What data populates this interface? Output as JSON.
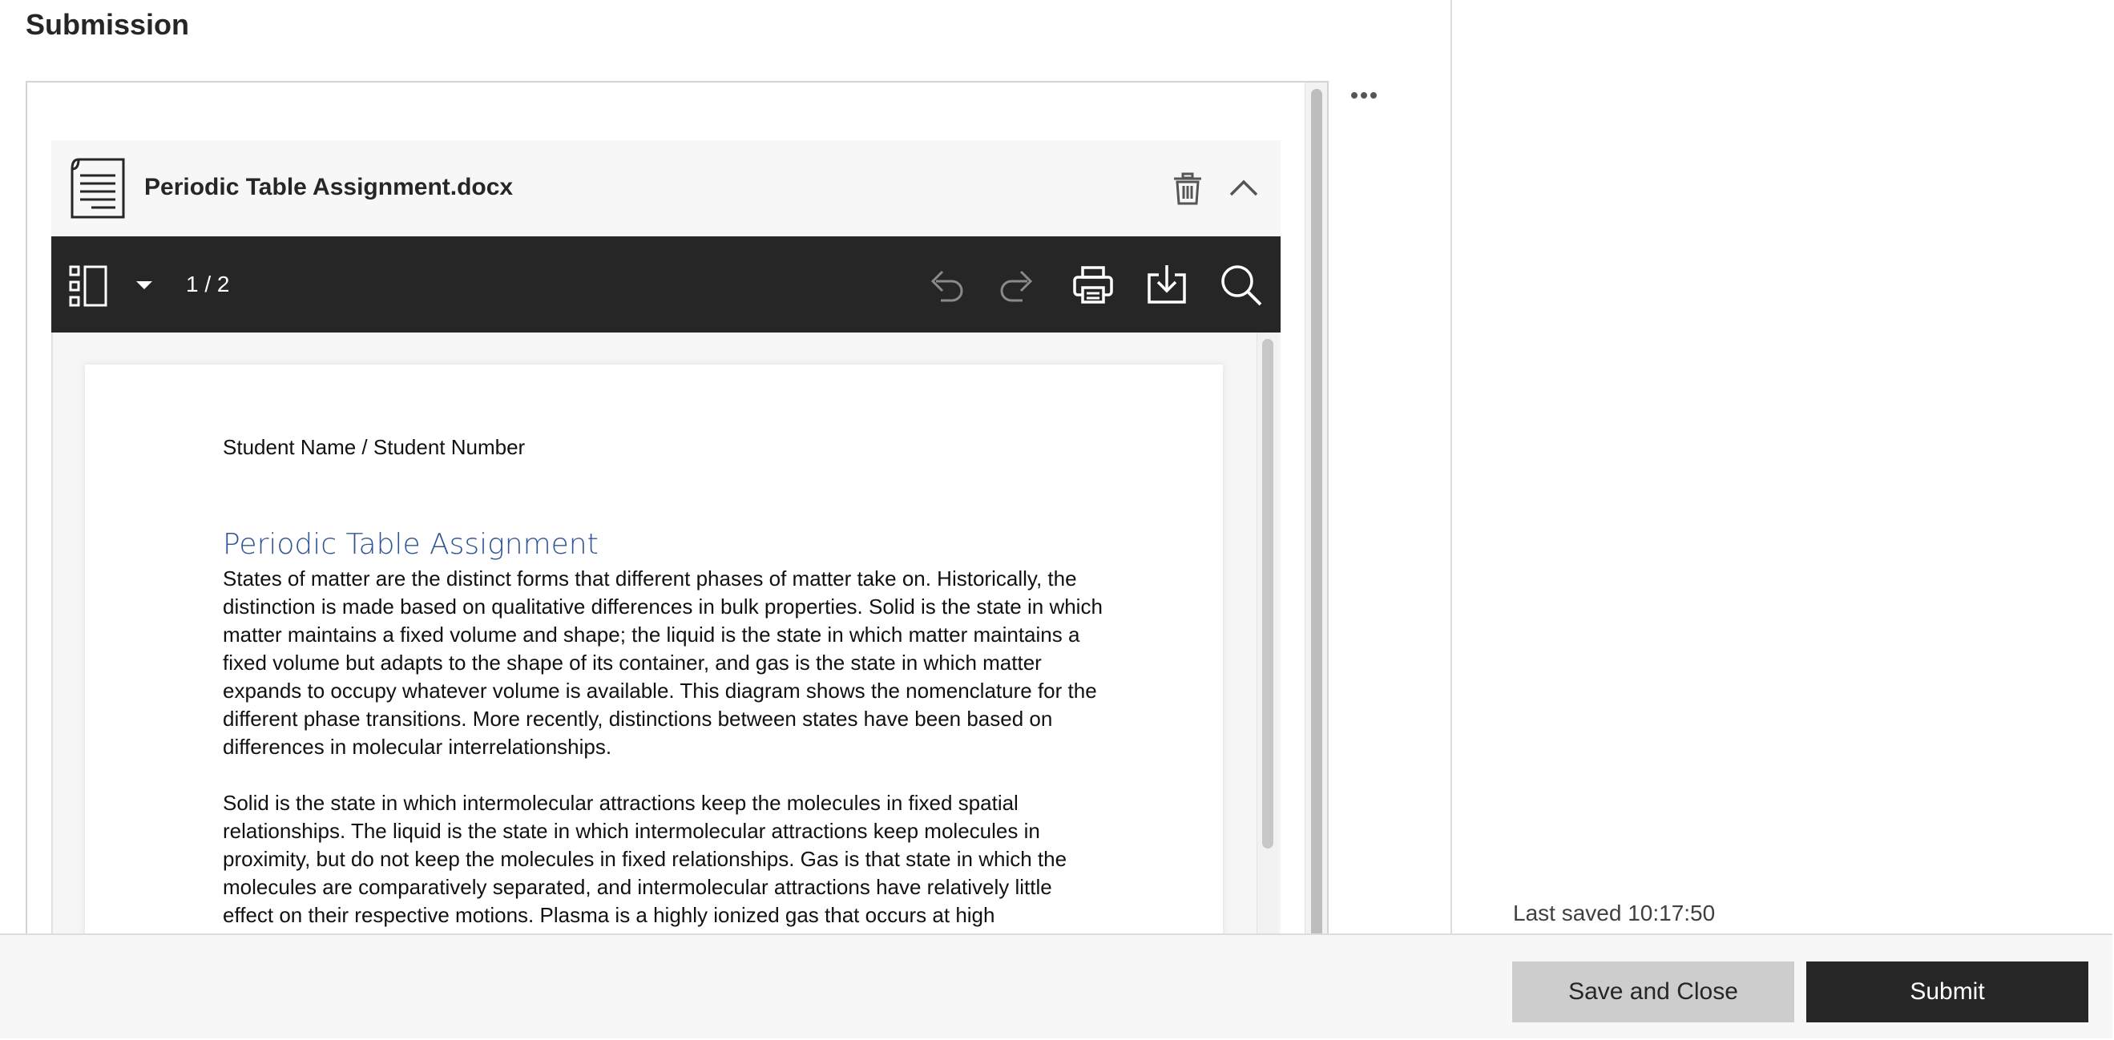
{
  "page": {
    "heading": "Submission",
    "last_saved": "Last saved 10:17:50"
  },
  "file": {
    "name": "Periodic Table Assignment.docx"
  },
  "viewer": {
    "page_count": "1 / 2"
  },
  "document": {
    "student_line": "Student Name / Student Number",
    "title": "Periodic Table Assignment",
    "paragraph_1": "States of matter are the distinct forms that different phases of matter take on. Historically, the distinction is made based on qualitative differences in bulk properties. Solid is the state in which matter maintains a fixed volume and shape; the liquid is the state in which matter maintains a fixed volume but adapts to the shape of its container, and gas is the state in which matter expands to occupy whatever volume is available. This diagram shows the nomenclature for the different phase transitions. More recently, distinctions between states have been based on differences in molecular interrelationships.",
    "paragraph_2": "Solid is the state in which intermolecular attractions keep the molecules in fixed spatial relationships. The liquid is the state in which intermolecular attractions keep molecules in proximity, but do not keep the molecules in fixed relationships. Gas is that state in which the molecules are comparatively separated, and intermolecular attractions have relatively little effect on their respective motions. Plasma is a highly ionized gas that occurs at high temperatures. The intermolecular forces created by ionic attractions and repulsions give these"
  },
  "footer": {
    "save_label": "Save and Close",
    "submit_label": "Submit"
  },
  "icons": {
    "more": "more-options-icon",
    "file": "document-file-icon",
    "trash": "trash-icon",
    "collapse": "chevron-up-icon",
    "thumbnails": "sidebar-thumbnails-icon",
    "dropdown": "caret-down-icon",
    "undo": "undo-icon",
    "redo": "redo-icon",
    "print": "print-icon",
    "download": "download-icon",
    "search": "search-icon"
  },
  "colors": {
    "toolbar_bg": "#262626",
    "doc_title": "#2f5596",
    "submit_bg": "#262626",
    "save_bg": "#cdcdcd"
  }
}
